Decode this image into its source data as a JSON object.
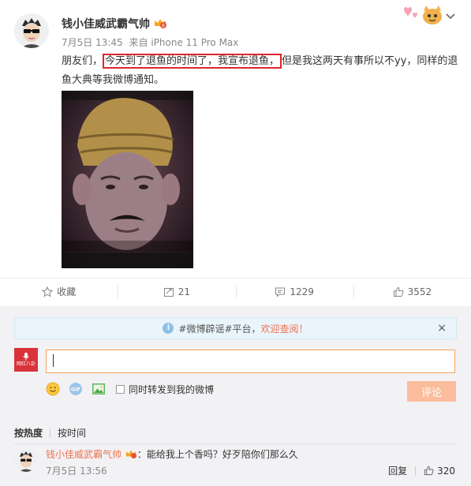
{
  "post": {
    "author": "钱小佳威武霸气帅",
    "date": "7月5日 13:45",
    "source": "来自 iPhone 11 Pro Max",
    "text_before": "朋友们，",
    "text_highlight": "今天到了退鱼的时间了，我宣布退鱼，",
    "text_after": "但是我这两天有事所以不yy，同样的退鱼大典等我微博通知。"
  },
  "actions": {
    "favorite_label": "收藏",
    "repost_count": "21",
    "comment_count": "1229",
    "like_count": "3552"
  },
  "notice": {
    "prefix": "#微博辟谣#平台，",
    "highlight": "欢迎查阅！",
    "close": "×"
  },
  "composer": {
    "avatar_text": "网红八卦",
    "repost_option": "同时转发到我的微博",
    "submit_label": "评论"
  },
  "sort": {
    "by_heat": "按热度",
    "by_time": "按时间"
  },
  "comment": {
    "author": "钱小佳威武霸气帅",
    "text": "：能给我上个香吗？好歹陪你们那么久",
    "time": "7月5日 13:56",
    "reply_label": "回复",
    "like_count": "320"
  },
  "colors": {
    "accent_orange": "#eb7350",
    "highlight_border": "#e0252b",
    "submit_disabled": "#fbbd9b"
  }
}
